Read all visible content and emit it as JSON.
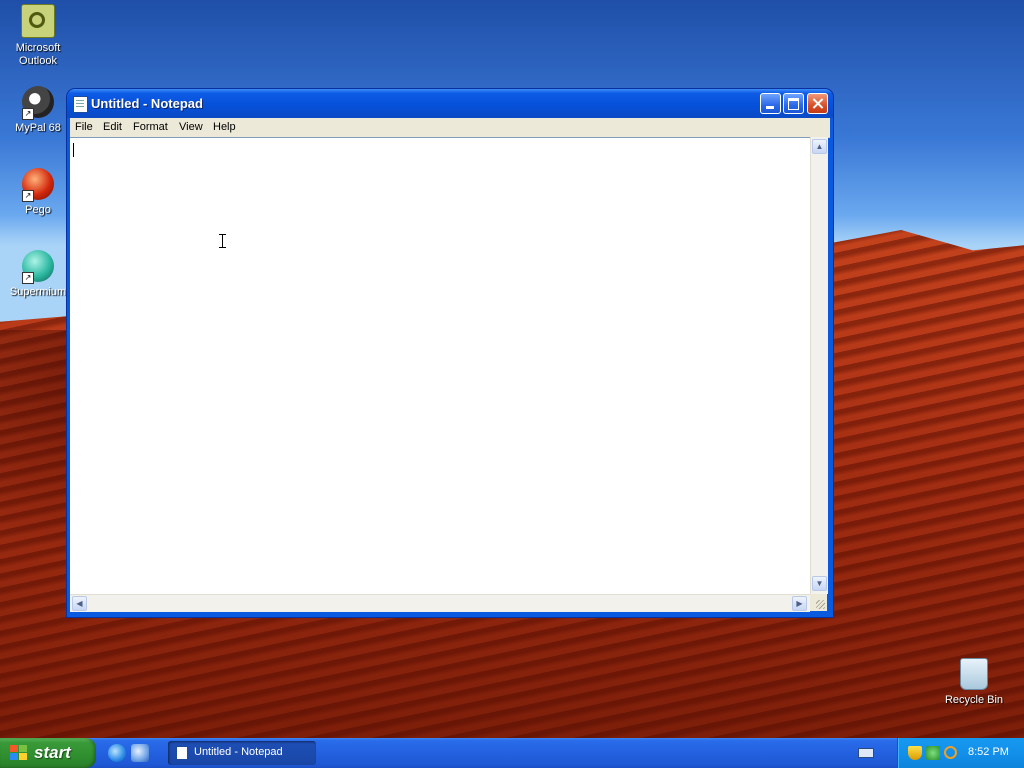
{
  "desktop": {
    "icons": [
      {
        "label": "Microsoft Outlook",
        "icon": "outlook-icon"
      },
      {
        "label": "MyPal 68",
        "icon": "mypal-icon"
      },
      {
        "label": "Pego",
        "icon": "pego-icon"
      },
      {
        "label": "Supermium",
        "icon": "supermium-icon"
      },
      {
        "label": "Recycle Bin",
        "icon": "recycle-bin-icon"
      }
    ]
  },
  "window": {
    "title": "Untitled - Notepad",
    "menu": [
      "File",
      "Edit",
      "Format",
      "View",
      "Help"
    ],
    "content": ""
  },
  "taskbar": {
    "start_label": "start",
    "quick_launch": [
      "internet-explorer-icon",
      "show-desktop-icon"
    ],
    "task_label": "Untitled - Notepad",
    "clock": "8:52 PM"
  },
  "colors": {
    "titlebar": "#0a5ae0",
    "taskbar": "#2361e0",
    "start_button": "#3a9a3a",
    "tray": "#1290ea"
  }
}
